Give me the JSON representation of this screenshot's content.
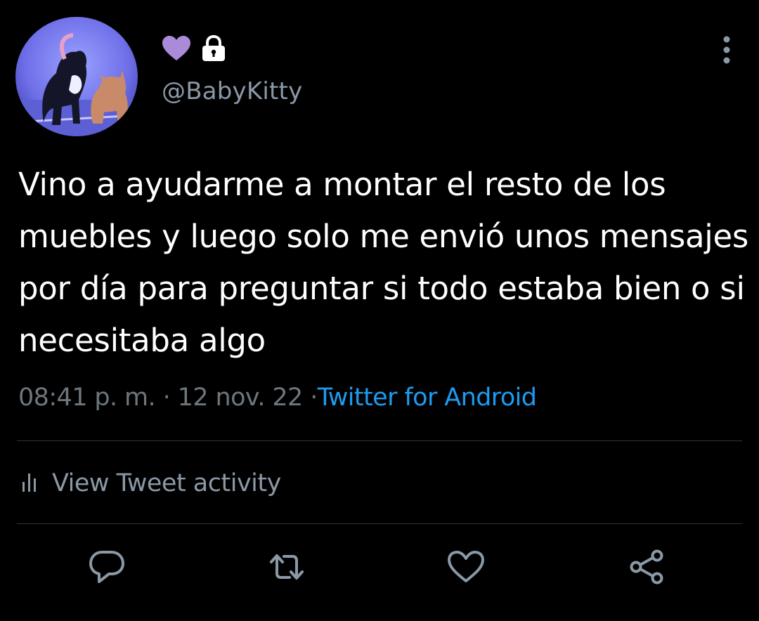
{
  "tweet": {
    "handle": "@BabyKitty",
    "badges": [
      "heart-icon",
      "lock-icon"
    ],
    "text": "Vino a ayudarme a montar el resto de los muebles y luego solo me envió unos mensajes por día para preguntar si todo estaba bien o si necesitaba algo",
    "time": "08:41 p. m.",
    "separator": "·",
    "date": "12 nov. 22",
    "source": "Twitter for Android",
    "activity_label": "View Tweet activity"
  },
  "actions": [
    "reply-icon",
    "retweet-icon",
    "like-icon",
    "share-icon"
  ],
  "colors": {
    "background": "#000000",
    "text": "#ffffff",
    "muted": "#8b98a5",
    "link": "#1d9bf0",
    "heart_badge": "#a98bd8",
    "divider": "#2f3336"
  }
}
